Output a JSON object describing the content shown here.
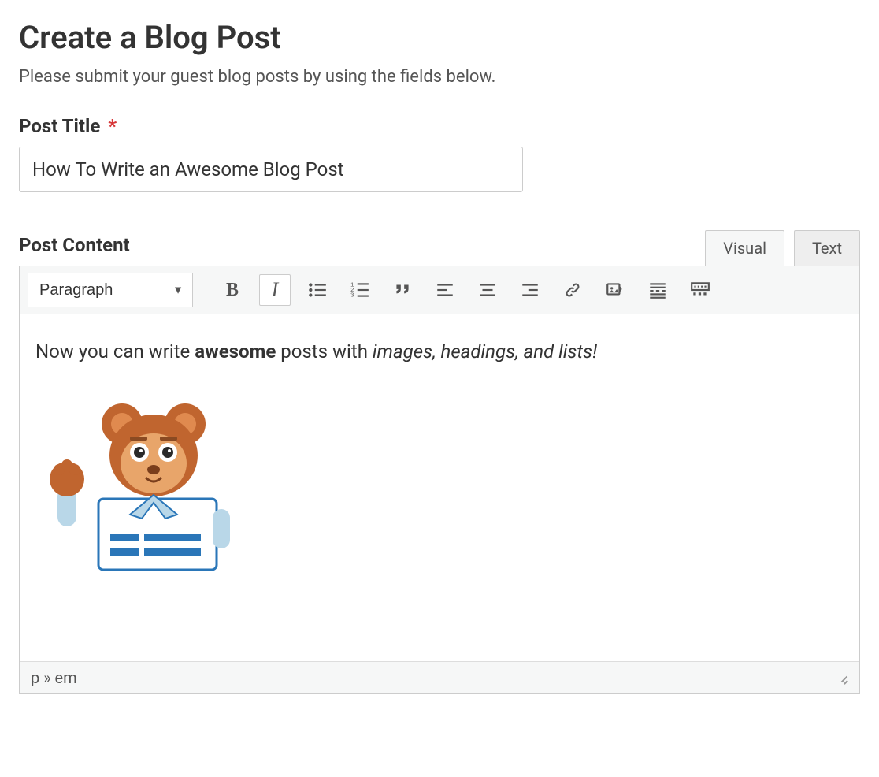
{
  "page": {
    "heading": "Create a Blog Post",
    "intro": "Please submit your guest blog posts by using the fields below."
  },
  "title_field": {
    "label": "Post Title",
    "required_mark": "*",
    "value": "How To Write an Awesome Blog Post"
  },
  "content_field": {
    "label": "Post Content",
    "tabs": {
      "visual": "Visual",
      "text": "Text"
    },
    "active_tab": "visual",
    "format_select": "Paragraph",
    "toolbar_buttons": {
      "bold": "B",
      "italic": "I",
      "bullet_list": "bullet-list-icon",
      "numbered_list": "numbered-list-icon",
      "blockquote": "blockquote-icon",
      "align_left": "align-left-icon",
      "align_center": "align-center-icon",
      "align_right": "align-right-icon",
      "link": "link-icon",
      "insert_media": "media-icon",
      "read_more": "read-more-icon",
      "toolbar_toggle": "toolbar-toggle-icon"
    },
    "body": {
      "text_prefix": "Now you can write ",
      "text_bold": "awesome",
      "text_mid": " posts with ",
      "text_italic": "images, headings, and lists!"
    },
    "status_path": "p » em"
  }
}
